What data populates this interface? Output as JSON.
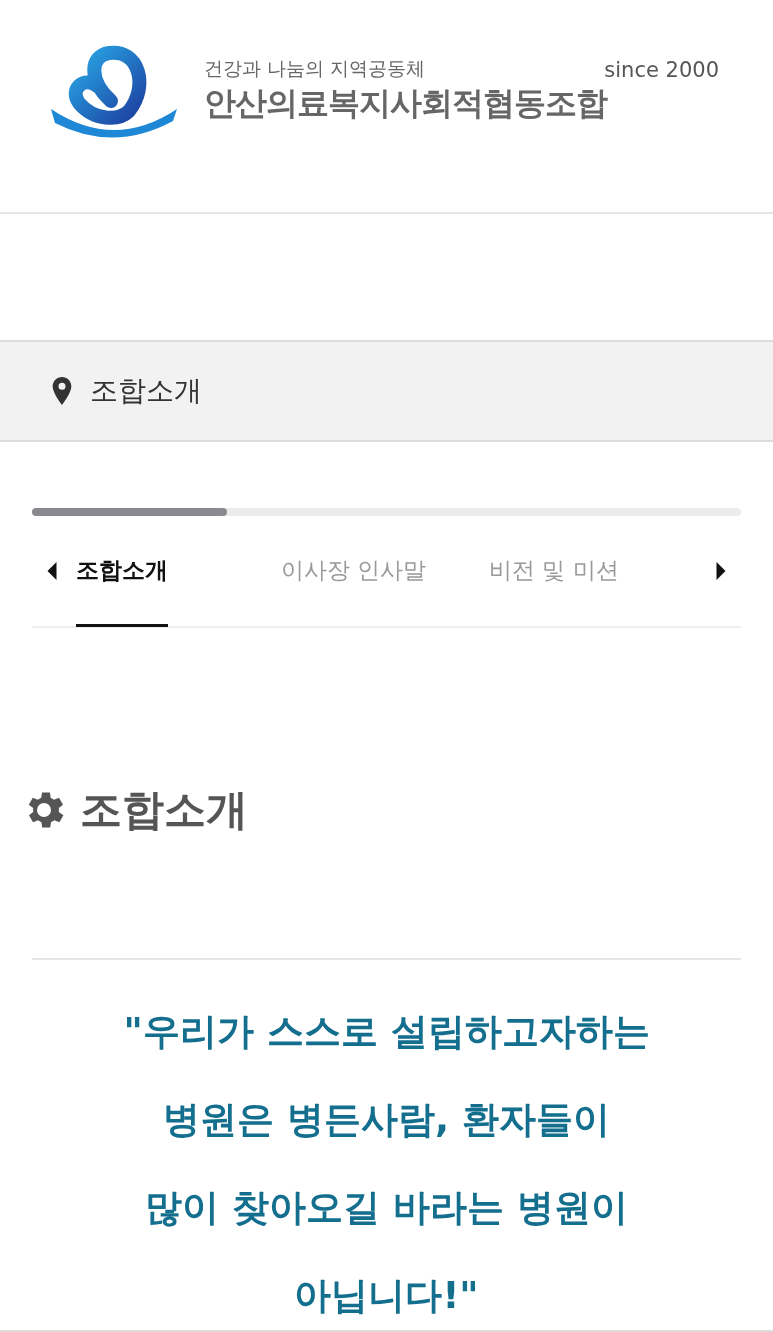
{
  "header": {
    "tagline": "건강과 나눔의 지역공동체",
    "since": "since 2000",
    "org_name": "안산의료복지사회적협동조합"
  },
  "breadcrumb": {
    "label": "조합소개"
  },
  "tabs": [
    {
      "label": "조합소개",
      "selected": true
    },
    {
      "label": "이사장 인사말",
      "selected": false
    },
    {
      "label": "비전 및 미션",
      "selected": false
    }
  ],
  "section": {
    "title": "조합소개",
    "quote": "\"우리가 스스로 설립하고자하는\n병원은 병든사람, 환자들이\n많이 찾아오길 바라는 병원이\n아닙니다!\""
  }
}
